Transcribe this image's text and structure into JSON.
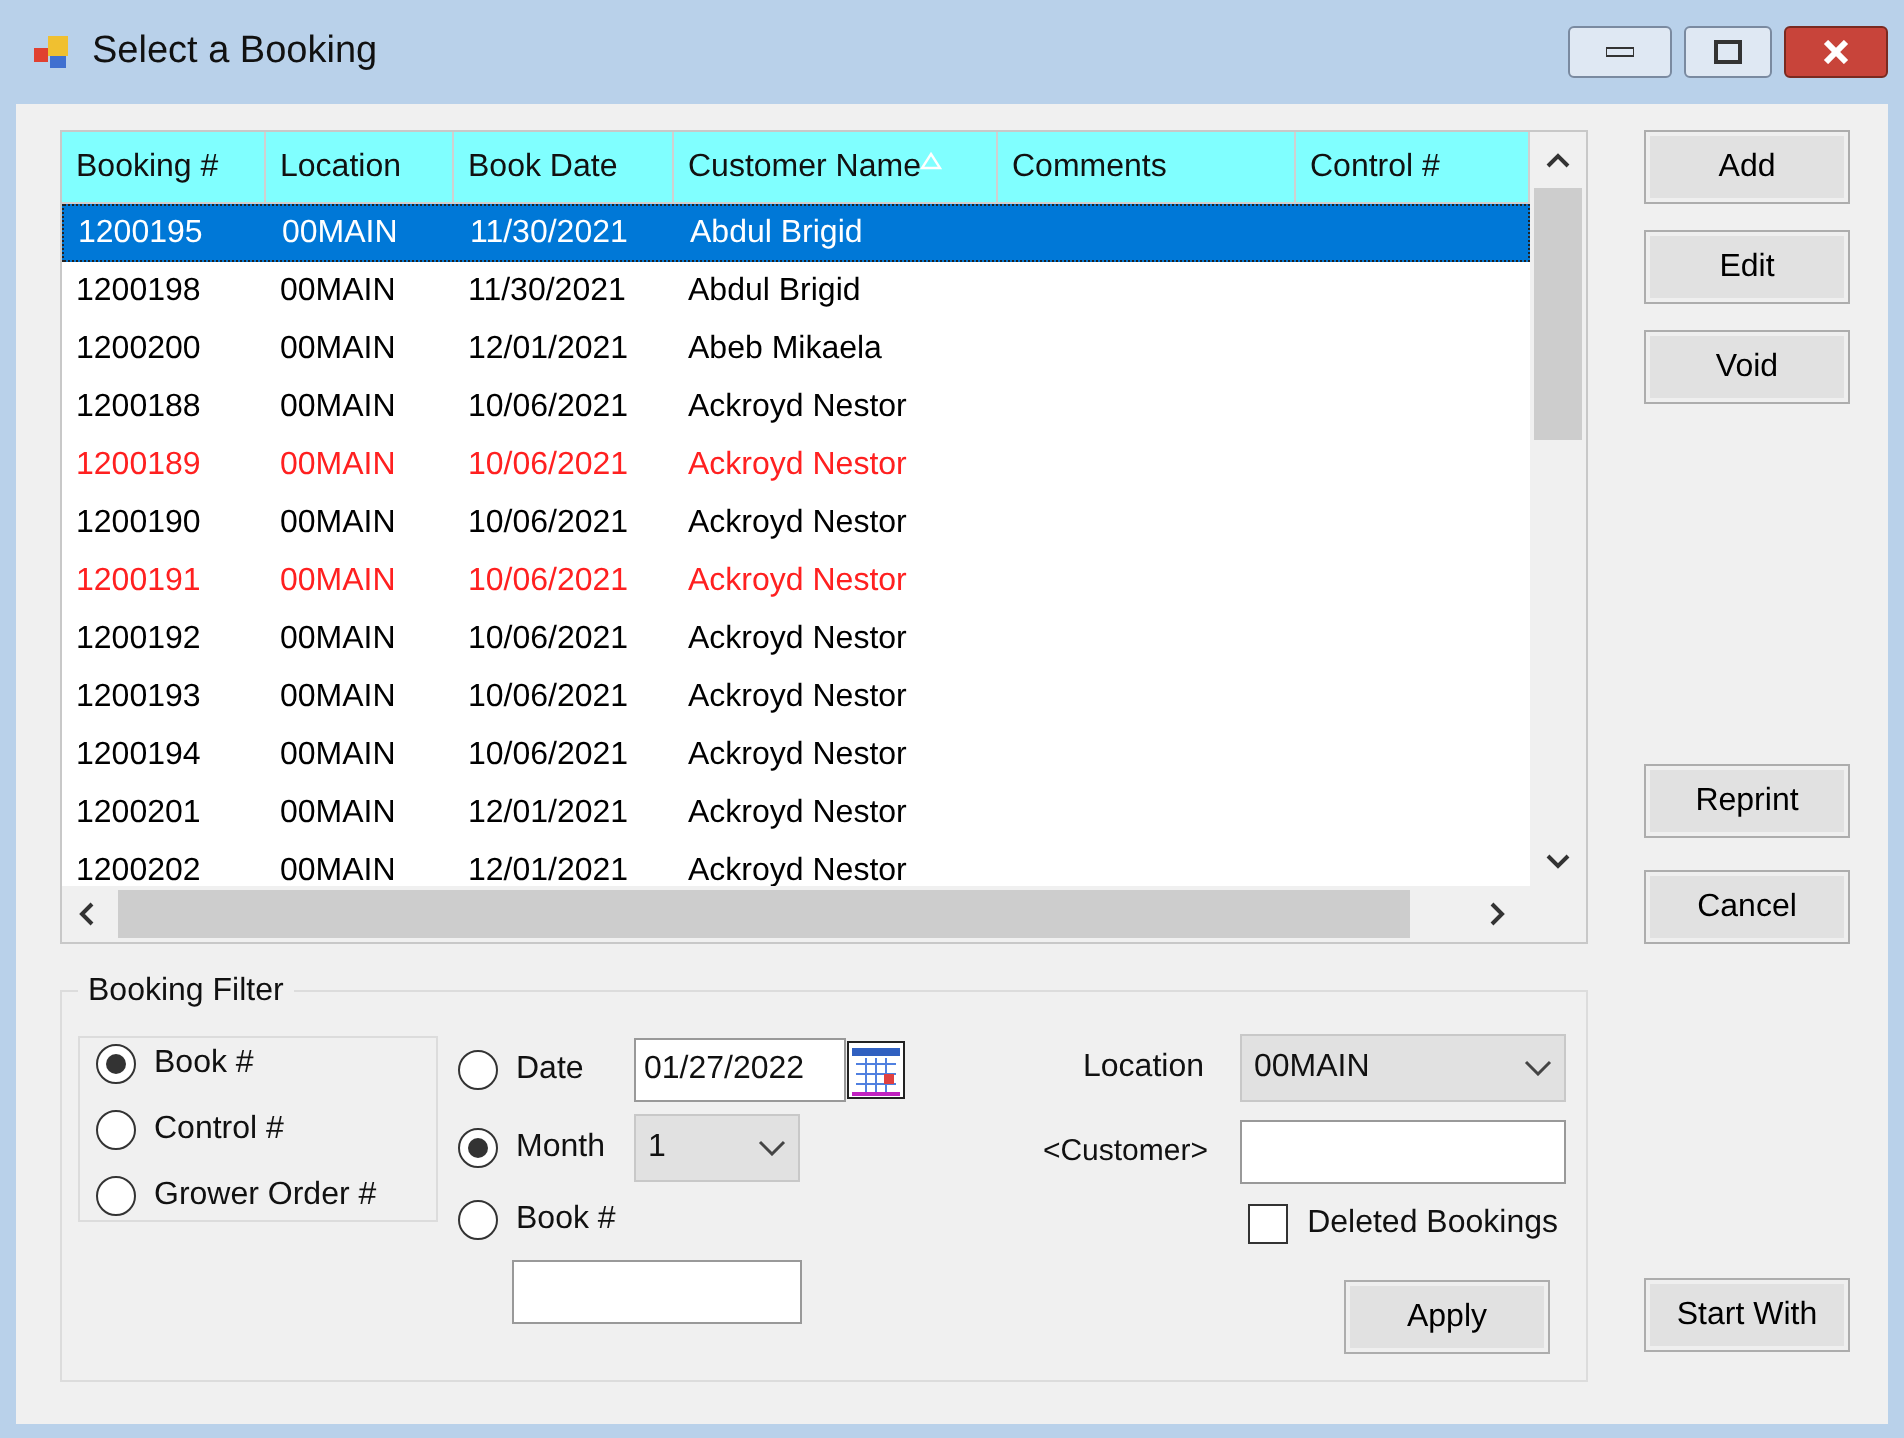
{
  "window": {
    "title": "Select a Booking"
  },
  "table": {
    "columns": [
      {
        "label": "Booking #",
        "sorted": false
      },
      {
        "label": "Location",
        "sorted": false
      },
      {
        "label": "Book Date",
        "sorted": false
      },
      {
        "label": "Customer Name",
        "sorted": true
      },
      {
        "label": "Comments",
        "sorted": false
      },
      {
        "label": "Control #",
        "sorted": false
      }
    ],
    "rows": [
      {
        "cells": [
          "1200195",
          "00MAIN",
          "11/30/2021",
          "Abdul Brigid",
          "",
          ""
        ],
        "selected": true,
        "color": "#ffffff"
      },
      {
        "cells": [
          "1200198",
          "00MAIN",
          "11/30/2021",
          "Abdul Brigid",
          "",
          ""
        ],
        "selected": false,
        "color": "#000000"
      },
      {
        "cells": [
          "1200200",
          "00MAIN",
          "12/01/2021",
          "Abeb Mikaela",
          "",
          ""
        ],
        "selected": false,
        "color": "#000000"
      },
      {
        "cells": [
          "1200188",
          "00MAIN",
          "10/06/2021",
          "Ackroyd Nestor",
          "",
          ""
        ],
        "selected": false,
        "color": "#000000"
      },
      {
        "cells": [
          "1200189",
          "00MAIN",
          "10/06/2021",
          "Ackroyd Nestor",
          "",
          ""
        ],
        "selected": false,
        "color": "#ff2020"
      },
      {
        "cells": [
          "1200190",
          "00MAIN",
          "10/06/2021",
          "Ackroyd Nestor",
          "",
          ""
        ],
        "selected": false,
        "color": "#000000"
      },
      {
        "cells": [
          "1200191",
          "00MAIN",
          "10/06/2021",
          "Ackroyd Nestor",
          "",
          ""
        ],
        "selected": false,
        "color": "#ff2020"
      },
      {
        "cells": [
          "1200192",
          "00MAIN",
          "10/06/2021",
          "Ackroyd Nestor",
          "",
          ""
        ],
        "selected": false,
        "color": "#000000"
      },
      {
        "cells": [
          "1200193",
          "00MAIN",
          "10/06/2021",
          "Ackroyd Nestor",
          "",
          ""
        ],
        "selected": false,
        "color": "#000000"
      },
      {
        "cells": [
          "1200194",
          "00MAIN",
          "10/06/2021",
          "Ackroyd Nestor",
          "",
          ""
        ],
        "selected": false,
        "color": "#000000"
      },
      {
        "cells": [
          "1200201",
          "00MAIN",
          "12/01/2021",
          "Ackroyd Nestor",
          "",
          ""
        ],
        "selected": false,
        "color": "#000000"
      },
      {
        "cells": [
          "1200202",
          "00MAIN",
          "12/01/2021",
          "Ackroyd Nestor",
          "",
          ""
        ],
        "selected": false,
        "color": "#000000"
      }
    ]
  },
  "side_buttons_top": [
    "Add",
    "Edit",
    "Void"
  ],
  "side_buttons_bottom": [
    "Reprint",
    "Cancel"
  ],
  "start_button": "Start With",
  "filter": {
    "title": "Booking Filter",
    "search_by": [
      {
        "label": "Book #",
        "selected": true
      },
      {
        "label": "Control #",
        "selected": false
      },
      {
        "label": "Grower Order #",
        "selected": false
      }
    ],
    "range": [
      {
        "kind": "date",
        "label": "Date",
        "selected": false,
        "value": "01/27/2022"
      },
      {
        "kind": "month",
        "label": "Month",
        "selected": true,
        "value": "1"
      },
      {
        "kind": "book",
        "label": "Book #",
        "selected": false
      }
    ],
    "location": {
      "label": "Location",
      "value": "00MAIN"
    },
    "customer": {
      "label": "<Customer>"
    },
    "deleted": {
      "label": "Deleted Bookings",
      "checked": false
    },
    "apply": "Apply"
  }
}
